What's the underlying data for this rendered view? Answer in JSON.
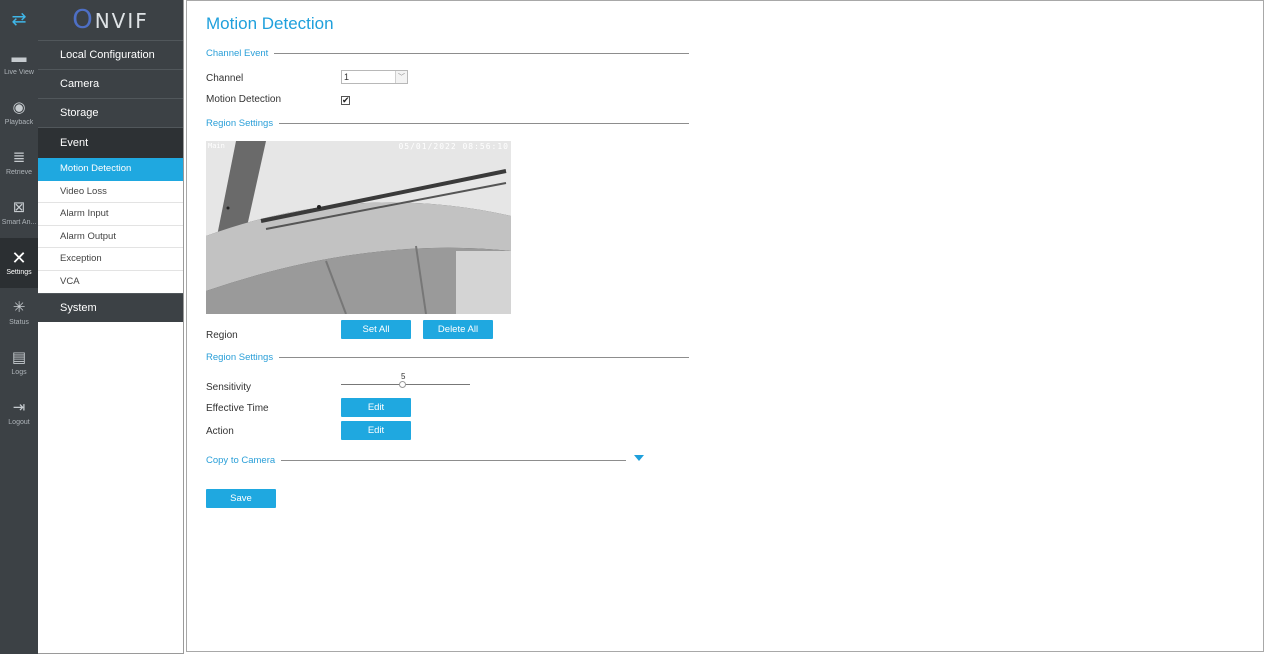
{
  "rail": {
    "items": [
      {
        "label": "Live View",
        "icon": "live-view-icon",
        "glyph": "▬"
      },
      {
        "label": "Playback",
        "icon": "playback-icon",
        "glyph": "◉"
      },
      {
        "label": "Retrieve",
        "icon": "retrieve-icon",
        "glyph": "≣"
      },
      {
        "label": "Smart An...",
        "icon": "smart-analytics-icon",
        "glyph": "⊠"
      },
      {
        "label": "Settings",
        "icon": "settings-icon",
        "glyph": "✕"
      },
      {
        "label": "Status",
        "icon": "status-icon",
        "glyph": "✳"
      },
      {
        "label": "Logs",
        "icon": "logs-icon",
        "glyph": "▤"
      },
      {
        "label": "Logout",
        "icon": "logout-icon",
        "glyph": "⇥"
      }
    ]
  },
  "logo": {
    "first": "O",
    "rest": "NVIF"
  },
  "menu": {
    "local_configuration": "Local Configuration",
    "camera": "Camera",
    "storage": "Storage",
    "event": "Event",
    "event_items": [
      "Motion Detection",
      "Video Loss",
      "Alarm Input",
      "Alarm Output",
      "Exception",
      "VCA"
    ],
    "system": "System"
  },
  "page": {
    "title": "Motion Detection",
    "channel_event": "Channel Event",
    "channel_label": "Channel",
    "channel_value": "1",
    "motion_detection_label": "Motion Detection",
    "motion_detection_checked": "✔",
    "region_settings_1": "Region Settings",
    "video_osd_left": "Main",
    "video_osd_right": "05/01/2022 08:56:10",
    "region_label": "Region",
    "set_all": "Set All",
    "delete_all": "Delete All",
    "region_settings_2": "Region Settings",
    "sensitivity_label": "Sensitivity",
    "sensitivity_value": "5",
    "effective_time_label": "Effective Time",
    "edit_1": "Edit",
    "action_label": "Action",
    "edit_2": "Edit",
    "copy_to_camera": "Copy to Camera",
    "save": "Save"
  },
  "colors": {
    "accent": "#1fa8e0",
    "rail_bg": "#3c4145"
  }
}
